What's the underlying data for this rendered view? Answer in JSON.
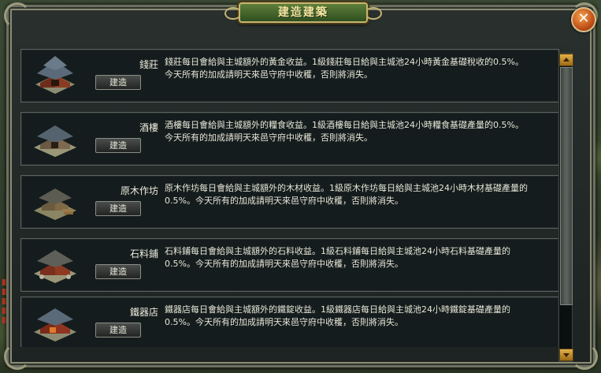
{
  "window": {
    "title": "建造建築"
  },
  "buildings": [
    {
      "name": "錢莊",
      "button": "建造",
      "desc_line1": "錢莊每日會給與主城額外的黃金收益。1級錢莊每日給與主城池24小時黃金基礎稅收的0.5%。",
      "desc_line2": "今天所有的加成請明天來邑守府中收穫，否則將消失。"
    },
    {
      "name": "酒樓",
      "button": "建造",
      "desc_line1": "酒樓每日會給與主城額外的糧食收益。1級酒樓每日給與主城池24小時糧食基礎產量的0.5%。",
      "desc_line2": "今天所有的加成請明天來邑守府中收穫，否則將消失。"
    },
    {
      "name": "原木作坊",
      "button": "建造",
      "desc_line1": "原木作坊每日會給與主城額外的木材收益。1級原木作坊每日給與主城池24小時木材基礎產量的",
      "desc_line2": "0.5%。今天所有的加成請明天來邑守府中收穫，否則將消失。"
    },
    {
      "name": "石料鋪",
      "button": "建造",
      "desc_line1": "石料鋪每日會給與主城額外的石料收益。1級石料鋪每日給與主城池24小時石料基礎產量的",
      "desc_line2": "0.5%。今天所有的加成請明天來邑守府中收穫，否則將消失。"
    },
    {
      "name": "鐵器店",
      "button": "建造",
      "desc_line1": "鐵器店每日會給與主城額外的鐵錠收益。1級鐵器店每日給與主城池24小時鐵錠基礎產量的",
      "desc_line2": "0.5%。今天所有的加成請明天來邑守府中收穫，否則將消失。"
    }
  ],
  "colors": {
    "roof": "#5a6a78",
    "wall": "#7a3a22",
    "base": "#8d8c72"
  },
  "icons": {
    "close": "close-icon",
    "scroll_up": "scroll-up-icon",
    "scroll_down": "scroll-down-icon"
  }
}
